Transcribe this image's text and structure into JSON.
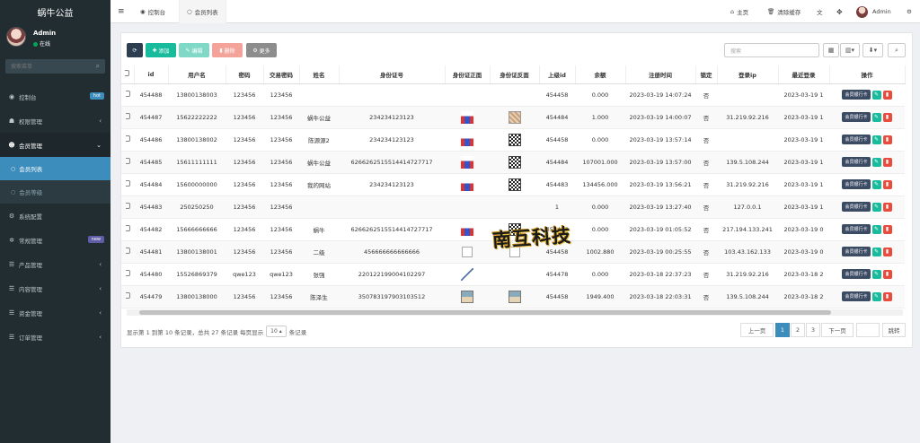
{
  "app": {
    "title": "蜗牛公益"
  },
  "user": {
    "name": "Admin",
    "status": "在线"
  },
  "sidebar": {
    "search_placeholder": "搜索菜单",
    "items": [
      {
        "label": "控制台",
        "badge": "hot",
        "badge_color": "#3c8dbc"
      },
      {
        "label": "权限管理"
      },
      {
        "label": "会员管理"
      },
      {
        "label": "系统配置"
      },
      {
        "label": "常规管理",
        "badge": "new",
        "badge_color": "#605ca8"
      },
      {
        "label": "产品管理"
      },
      {
        "label": "内容管理"
      },
      {
        "label": "资金管理"
      },
      {
        "label": "订单管理"
      }
    ],
    "sub_items": [
      {
        "label": "会员列表"
      },
      {
        "label": "会员等级"
      }
    ]
  },
  "topbar": {
    "tab_dashboard": "控制台",
    "tab_members": "会员列表",
    "home": "主页",
    "clear_cache": "清除缓存",
    "user": "Admin"
  },
  "toolbar": {
    "add": "添加",
    "edit": "编辑",
    "delete": "删除",
    "more": "更多",
    "search_placeholder": "搜索"
  },
  "table": {
    "headers": [
      "id",
      "用户名",
      "密码",
      "交易密码",
      "姓名",
      "身份证号",
      "身份证正面",
      "身份证反面",
      "上级id",
      "余额",
      "注册时间",
      "锁定",
      "登录ip",
      "最近登录",
      "操作"
    ],
    "rows": [
      {
        "id": "454488",
        "username": "13800138003",
        "pwd": "123456",
        "tpwd": "123456",
        "name": "",
        "idno": "",
        "front": "",
        "back": "",
        "pid": "454458",
        "balance": "0.000",
        "reg": "2023-03-19 14:07:24",
        "lock": "否",
        "ip": "",
        "last": "2023-03-19 1"
      },
      {
        "id": "454487",
        "username": "15622222222",
        "pwd": "123456",
        "tpwd": "123456",
        "name": "蜗牛公益",
        "idno": "234234123123",
        "front": "flag",
        "back": "photo",
        "pid": "454484",
        "balance": "1.000",
        "reg": "2023-03-19 14:00:07",
        "lock": "否",
        "ip": "31.219.92.216",
        "last": "2023-03-19 1"
      },
      {
        "id": "454486",
        "username": "13800138002",
        "pwd": "123456",
        "tpwd": "123456",
        "name": "陈源源2",
        "idno": "234234123123",
        "front": "flag",
        "back": "qr",
        "pid": "454458",
        "balance": "0.000",
        "reg": "2023-03-19 13:57:14",
        "lock": "否",
        "ip": "",
        "last": "2023-03-19 1"
      },
      {
        "id": "454485",
        "username": "15611111111",
        "pwd": "123456",
        "tpwd": "123456",
        "name": "蜗牛公益",
        "idno": "626626251551441472771​7",
        "front": "flag",
        "back": "qr",
        "pid": "454484",
        "balance": "107001.000",
        "reg": "2023-03-19 13:57:00",
        "lock": "否",
        "ip": "139.5.108.244",
        "last": "2023-03-19 1"
      },
      {
        "id": "454484",
        "username": "15600000000",
        "pwd": "123456",
        "tpwd": "123456",
        "name": "我的网站",
        "idno": "234234123123",
        "front": "flag",
        "back": "qr",
        "pid": "454483",
        "balance": "134456.000",
        "reg": "2023-03-19 13:56:21",
        "lock": "否",
        "ip": "31.219.92.216",
        "last": "2023-03-19 1"
      },
      {
        "id": "454483",
        "username": "250250250",
        "pwd": "123456",
        "tpwd": "123456",
        "name": "",
        "idno": "",
        "front": "",
        "back": "",
        "pid": "1",
        "balance": "0.000",
        "reg": "2023-03-19 13:27:40",
        "lock": "否",
        "ip": "127.0.0.1",
        "last": "2023-03-19 1"
      },
      {
        "id": "454482",
        "username": "15666666666",
        "pwd": "123456",
        "tpwd": "123456",
        "name": "蜗牛",
        "idno": "626626251551441472771​7",
        "front": "flag",
        "back": "qr",
        "pid": "454466",
        "balance": "0.000",
        "reg": "2023-03-19 01:05:52",
        "lock": "否",
        "ip": "217.194.133.241",
        "last": "2023-03-19 0"
      },
      {
        "id": "454481",
        "username": "13800138001",
        "pwd": "123456",
        "tpwd": "123456",
        "name": "二级",
        "idno": "456666666666666",
        "front": "broken",
        "back": "broken",
        "pid": "454458",
        "balance": "1002.880",
        "reg": "2023-03-19 00:25:55",
        "lock": "否",
        "ip": "103.43.162.133",
        "last": "2023-03-19 0"
      },
      {
        "id": "454480",
        "username": "15526869379",
        "pwd": "qwe123",
        "tpwd": "qwe123",
        "name": "张强",
        "idno": "220122199004102297",
        "front": "chart",
        "back": "",
        "pid": "454478",
        "balance": "0.000",
        "reg": "2023-03-18 22:37:23",
        "lock": "否",
        "ip": "31.219.92.216",
        "last": "2023-03-18 2"
      },
      {
        "id": "454479",
        "username": "13800138000",
        "pwd": "123456",
        "tpwd": "123456",
        "name": "陈泽生",
        "idno": "350783197903103512",
        "front": "pic",
        "back": "pic",
        "pid": "454458",
        "balance": "1949.400",
        "reg": "2023-03-18 22:03:31",
        "lock": "否",
        "ip": "139.5.108.244",
        "last": "2023-03-18 2"
      }
    ],
    "op_bank": "会员银行卡"
  },
  "pagination": {
    "info_prefix": "显示第 1 到第 10 条记录，总共 27 条记录 每页显示",
    "page_size": "10",
    "info_suffix": "条记录",
    "prev": "上一页",
    "pages": [
      "1",
      "2",
      "3"
    ],
    "next": "下一页",
    "go": "跳转"
  },
  "watermark": "南互科技",
  "colors": {
    "add": "#18bc9c",
    "edit": "#3fd0b0",
    "delete": "#f08c80",
    "more": "#888888",
    "refresh": "#2c3e50"
  }
}
